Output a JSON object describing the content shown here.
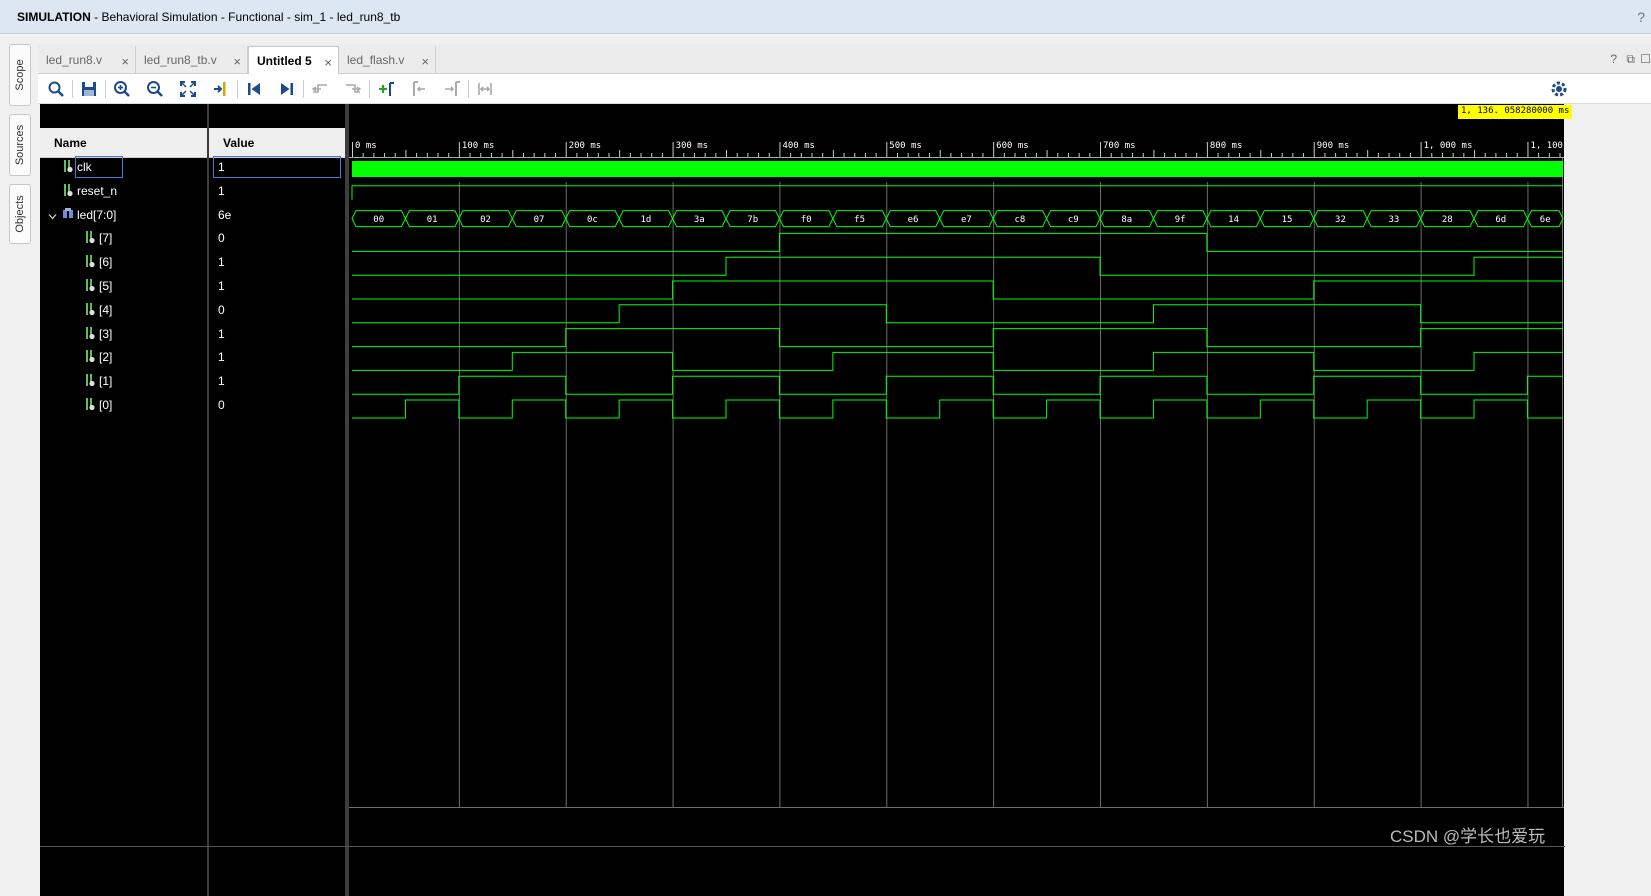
{
  "titlebar": {
    "mode": "SIMULATION",
    "title": " - Behavioral Simulation - Functional - sim_1 - led_run8_tb",
    "help": "?"
  },
  "side_tabs": [
    "Scope",
    "Sources",
    "Objects"
  ],
  "tabs": [
    {
      "label": "led_run8.v",
      "active": false
    },
    {
      "label": "led_run8_tb.v",
      "active": false
    },
    {
      "label": "Untitled 5",
      "active": true
    },
    {
      "label": "led_flash.v",
      "active": false
    }
  ],
  "tab_close": "×",
  "tabbar_controls": [
    "?",
    "⧉",
    "☐"
  ],
  "toolbar_icons": [
    "search-icon",
    "save-icon",
    "zoom-in-icon",
    "zoom-out-icon",
    "zoom-fit-icon",
    "go-to-cursor-icon",
    "go-to-start-icon",
    "go-to-end-icon",
    "previous-transition-icon",
    "next-transition-icon",
    "add-marker-icon",
    "previous-marker-icon",
    "next-marker-icon",
    "swap-cursors-icon"
  ],
  "settings_icon": "gear-icon",
  "columns": {
    "name": "Name",
    "value": "Value"
  },
  "signals": [
    {
      "name": "clk",
      "value": "1",
      "kind": "bit",
      "indent": 0,
      "selected": true
    },
    {
      "name": "reset_n",
      "value": "1",
      "kind": "bit",
      "indent": 0
    },
    {
      "name": "led[7:0]",
      "value": "6e",
      "kind": "bus",
      "indent": 0,
      "expanded": true
    },
    {
      "name": "[7]",
      "value": "0",
      "kind": "bit",
      "indent": 1
    },
    {
      "name": "[6]",
      "value": "1",
      "kind": "bit",
      "indent": 1
    },
    {
      "name": "[5]",
      "value": "1",
      "kind": "bit",
      "indent": 1
    },
    {
      "name": "[4]",
      "value": "0",
      "kind": "bit",
      "indent": 1
    },
    {
      "name": "[3]",
      "value": "1",
      "kind": "bit",
      "indent": 1
    },
    {
      "name": "[2]",
      "value": "1",
      "kind": "bit",
      "indent": 1
    },
    {
      "name": "[1]",
      "value": "1",
      "kind": "bit",
      "indent": 1
    },
    {
      "name": "[0]",
      "value": "0",
      "kind": "bit",
      "indent": 1
    }
  ],
  "timeline": {
    "unit": "ms",
    "labels": [
      "0 ms",
      "100 ms",
      "200 ms",
      "300 ms",
      "400 ms",
      "500 ms",
      "600 ms",
      "700 ms",
      "800 ms",
      "900 ms",
      "1, 000 ms",
      "1, 100 ms"
    ],
    "major_step": 100,
    "view_start": 0,
    "view_end": 1136,
    "cursor_readout": "1, 136. 058280000 ms"
  },
  "led_bus": {
    "segment_ms": 50,
    "values": [
      "00",
      "01",
      "02",
      "07",
      "0c",
      "1d",
      "3a",
      "7b",
      "f0",
      "f5",
      "e6",
      "e7",
      "c8",
      "c9",
      "8a",
      "9f",
      "14",
      "15",
      "32",
      "33",
      "28",
      "6d",
      "6e"
    ]
  },
  "colors": {
    "wave": "#00ff00",
    "grid": "#6e6e6e",
    "cursor": "#ffff00",
    "background": "#000000"
  },
  "watermark": "CSDN @学长也爱玩"
}
